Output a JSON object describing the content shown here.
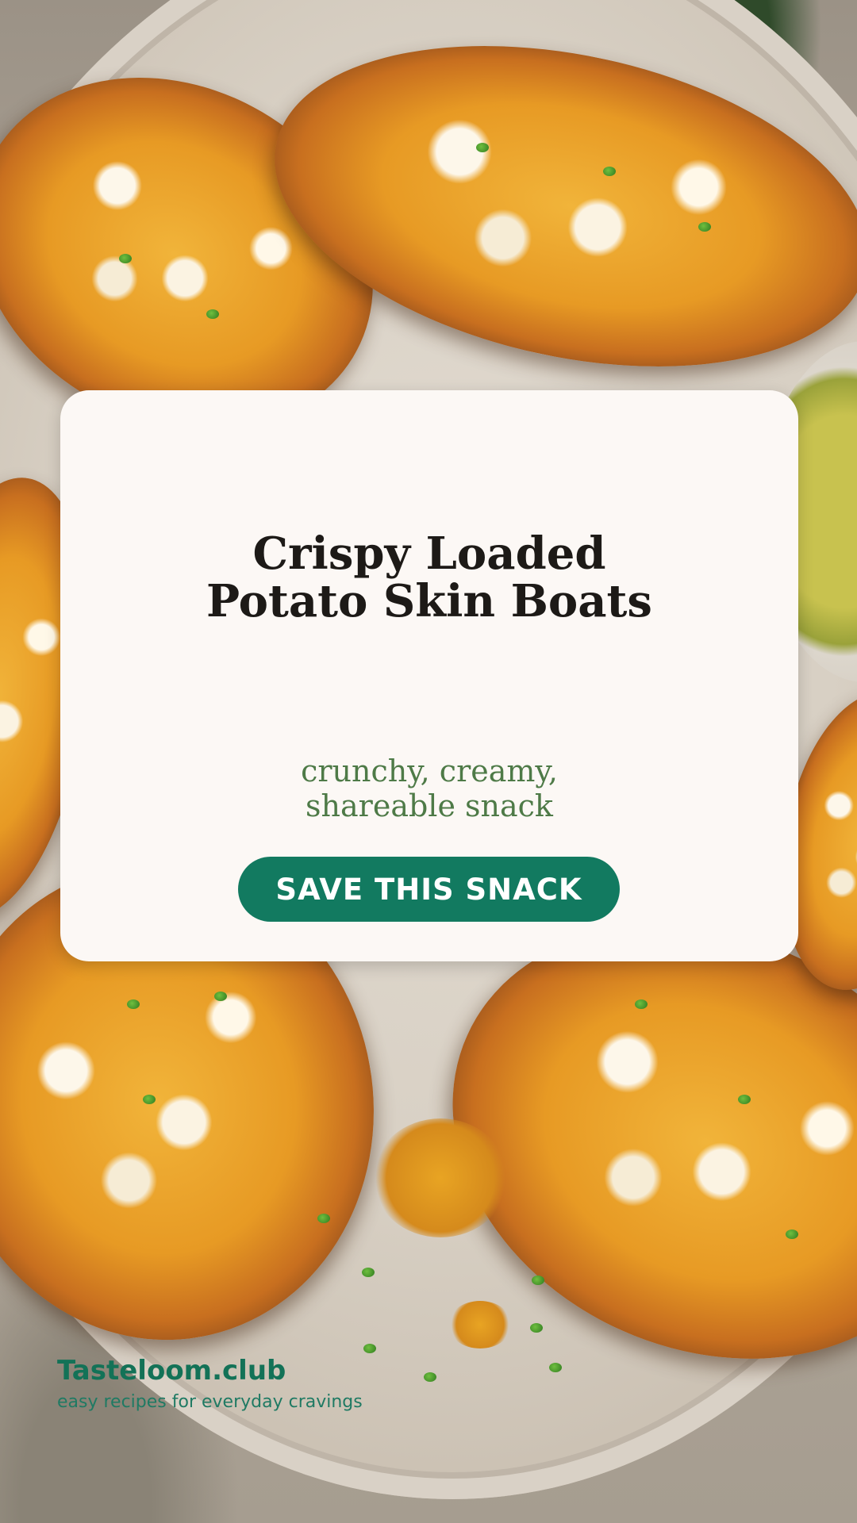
{
  "background": {
    "photo_description_icon": "potato-skins-photo"
  },
  "card": {
    "title_line1": "Crispy Loaded",
    "title_line2": "Potato Skin Boats",
    "subtitle_line1": "crunchy, creamy,",
    "subtitle_line2": "shareable snack",
    "cta_label": "SAVE THIS SNACK"
  },
  "brand": {
    "name": "Tasteloom.club",
    "tagline": "easy recipes for everyday cravings"
  },
  "colors": {
    "card_background": "#fcf8f5",
    "title": "#1d1a17",
    "subtitle": "#4e7a47",
    "button": "#127a60",
    "brand": "#137257"
  }
}
